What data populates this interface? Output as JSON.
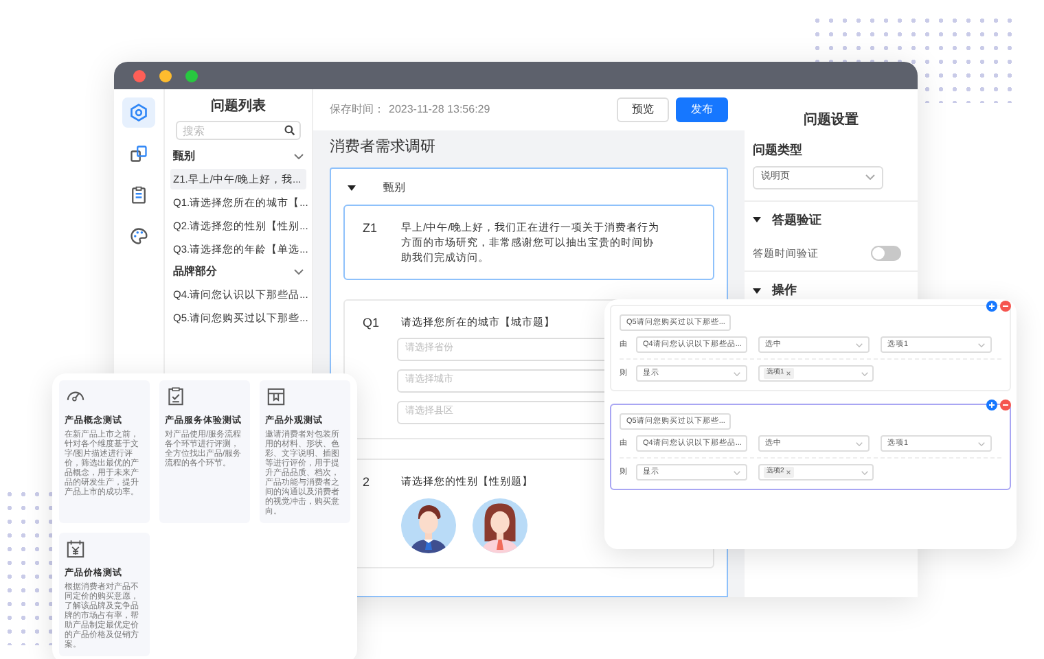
{
  "icon_rail": {
    "items": [
      {
        "selected": true
      },
      {
        "selected": false
      },
      {
        "selected": false
      },
      {
        "selected": false
      }
    ]
  },
  "question_list": {
    "title": "问题列表",
    "search": {
      "placeholder": "搜索"
    },
    "groups": [
      {
        "label": "甄别",
        "expanded": true,
        "items": [
          {
            "label": "Z1.早上/中午/晚上好，我...",
            "selected": true
          },
          {
            "label": "Q1.请选择您所在的城市【...",
            "selected": false
          },
          {
            "label": "Q2.请选择您的性别【性别...",
            "selected": false
          },
          {
            "label": "Q3.请选择您的年龄【单选...",
            "selected": false
          }
        ]
      },
      {
        "label": "品牌部分",
        "expanded": true,
        "items": [
          {
            "label": "Q4.请问您认识以下那些品...",
            "selected": false
          },
          {
            "label": "Q5.请问您购买过以下那些...",
            "selected": false
          }
        ]
      }
    ]
  },
  "editor": {
    "save_label": "保存时间：",
    "save_time": "2023-11-28 13:56:29",
    "buttons": [
      {
        "label": "预览",
        "kind": "default"
      },
      {
        "label": "发布",
        "kind": "primary"
      }
    ],
    "survey_title": "消费者需求调研",
    "section": {
      "label": "甄别",
      "expanded": true
    },
    "questions": [
      {
        "number": "Z1",
        "kind": "text",
        "selected": true,
        "text": "早上/中午/晚上好，我们正在进行一项关于消费者行为方面的市场研究，非常感谢您可以抽出宝贵的时间协助我们完成访问。"
      },
      {
        "number": "Q1",
        "kind": "city",
        "selected": false,
        "text": "请选择您所在的城市【城市题】",
        "fields": [
          {
            "placeholder": "请选择省份"
          },
          {
            "placeholder": "请选择城市"
          },
          {
            "placeholder": "请选择县区"
          }
        ]
      },
      {
        "number": "2",
        "kind": "gender",
        "selected": false,
        "text": "请选择您的性别【性别题】",
        "options": [
          {
            "kind": "male"
          },
          {
            "kind": "female"
          }
        ]
      }
    ]
  },
  "settings": {
    "title": "问题设置",
    "type_label": "问题类型",
    "type_value": "说明页",
    "sections": [
      {
        "label": "答题验证",
        "expanded": true,
        "toggles": [
          {
            "label": "答题时间验证",
            "on": false
          }
        ]
      },
      {
        "label": "操作",
        "expanded": true
      }
    ]
  },
  "logic_rules": [
    {
      "selected": false,
      "target": "Q5请问您购买过以下那些...",
      "condition_label": "由",
      "source": "Q4请问您认识以下那些品...",
      "operator": "选中",
      "option": "选项1",
      "action_label": "则",
      "action": "显示",
      "tags": [
        "选项1"
      ]
    },
    {
      "selected": true,
      "target": "Q5请问您购买过以下那些...",
      "condition_label": "由",
      "source": "Q4请问您认识以下那些品...",
      "operator": "选中",
      "option": "选项1",
      "action_label": "则",
      "action": "显示",
      "tags": [
        "选项2"
      ]
    }
  ],
  "templates": [
    {
      "kind": "gauge",
      "title": "产品概念测试",
      "description": "在新产品上市之前，针对各个维度基于文字/图片描述进行评价，筛选出最优的产品概念，用于未来产品的研发生产，提升产品上市的成功率。"
    },
    {
      "kind": "clipboard",
      "title": "产品服务体验测试",
      "description": "对产品使用/服务流程各个环节进行评测，全方位找出产品/服务流程的各个环节。"
    },
    {
      "kind": "box",
      "title": "产品外观测试",
      "description": "邀请消费者对包装所用的材料、形状、色彩、文字说明、插图等进行评价，用于提升产品品质、档次，产品功能与消费者之间的沟通以及消费者的视觉冲击，购买意向。"
    },
    {
      "kind": "price",
      "title": "产品价格测试",
      "description": "根据消费者对产品不同定价的购买意愿，了解该品牌及竞争品牌的市场占有率，帮助产品制定最优定价的产品价格及促销方案。"
    }
  ]
}
